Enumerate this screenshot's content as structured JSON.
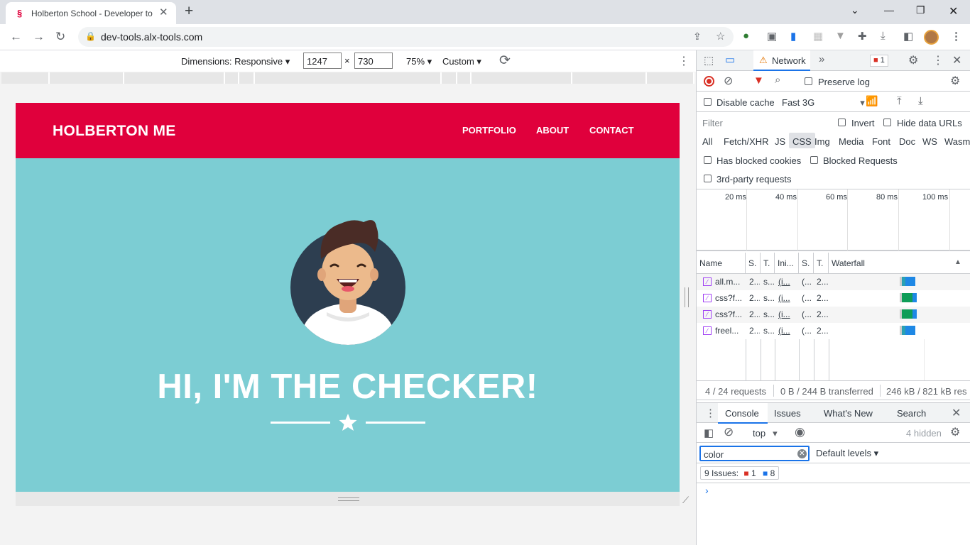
{
  "browser": {
    "tab_title": "Holberton School - Developer to",
    "url": "dev-tools.alx-tools.com"
  },
  "device_toolbar": {
    "dimensions_label": "Dimensions: Responsive",
    "width": "1247",
    "times": "×",
    "height": "730",
    "zoom": "75%",
    "throttle": "Custom"
  },
  "site": {
    "logo": "HOLBERTON ME",
    "nav": [
      "PORTFOLIO",
      "ABOUT",
      "CONTACT"
    ],
    "hero_title": "HI, I'M THE CHECKER!"
  },
  "devtools": {
    "tabs": {
      "network": "Network",
      "issues_count": "1"
    },
    "net_toolbar": {
      "preserve_log": "Preserve log",
      "disable_cache": "Disable cache",
      "throttling": "Fast 3G"
    },
    "filter": {
      "placeholder": "Filter",
      "invert": "Invert",
      "hide_data_urls": "Hide data URLs"
    },
    "types": [
      "All",
      "Fetch/XHR",
      "JS",
      "CSS",
      "Img",
      "Media",
      "Font",
      "Doc",
      "WS",
      "Wasm"
    ],
    "active_type": "CSS",
    "checks": {
      "blocked_cookies": "Has blocked cookies",
      "blocked_requests": "Blocked Requests",
      "third_party": "3rd-party requests"
    },
    "overview_ticks": [
      "20 ms",
      "40 ms",
      "60 ms",
      "80 ms",
      "100 ms"
    ],
    "table": {
      "columns": [
        "Name",
        "S.",
        "T.",
        "Ini...",
        "S.",
        "T.",
        "Waterfall"
      ],
      "rows": [
        [
          "all.m...",
          "2...",
          "s...",
          "(i...",
          "(...",
          "2..."
        ],
        [
          "css?f...",
          "2...",
          "s...",
          "(i...",
          "(...",
          "2..."
        ],
        [
          "css?f...",
          "2...",
          "s...",
          "(i...",
          "(...",
          "2..."
        ],
        [
          "freel...",
          "2...",
          "s...",
          "(i...",
          "(...",
          "2..."
        ]
      ]
    },
    "status": {
      "requests": "4 / 24 requests",
      "transferred": "0 B / 244 B transferred",
      "resources": "246 kB / 821 kB res"
    },
    "drawer_tabs": [
      "Console",
      "Issues",
      "What's New",
      "Search"
    ],
    "console": {
      "context": "top",
      "hidden": "4 hidden",
      "filter_value": "color",
      "levels": "Default levels",
      "issues_label": "9 Issues:",
      "issues_error": "1",
      "issues_info": "8",
      "prompt": "›"
    }
  },
  "colors": {
    "brand_red": "#e0003c",
    "hero_bg": "#7ccdd3",
    "devtools_accent": "#1a73e8"
  }
}
